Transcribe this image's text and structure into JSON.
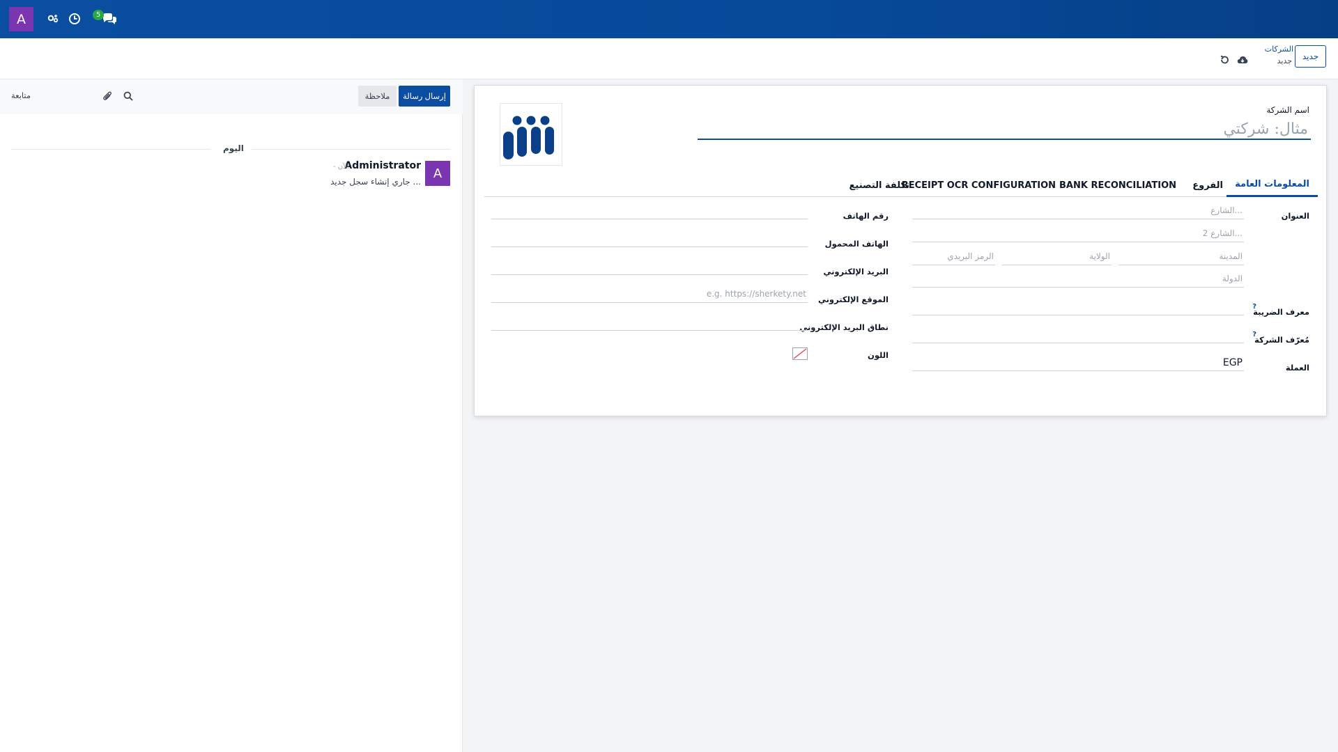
{
  "navbar": {
    "avatar_letter": "A",
    "messages_badge": "5",
    "icons": [
      "settings-users-icon",
      "clock-icon",
      "chat-bubbles-icon"
    ],
    "bg_color": "#0b4ea1"
  },
  "control_panel": {
    "new_button": "جديد",
    "breadcrumb_parent": "الشركات",
    "breadcrumb_current": "جديد",
    "icons": [
      "cloud-save-icon",
      "discard-icon"
    ]
  },
  "form": {
    "company_name_label": "اسم الشركة",
    "company_name_placeholder": "مثال: شركتي",
    "tabs": [
      {
        "label": "المعلومات العامة",
        "active": true
      },
      {
        "label": "الفروع",
        "active": false
      },
      {
        "label": "BANK RECONCILIATION",
        "active": false
      },
      {
        "label": "RECEIPT OCR CONFIGURATION",
        "active": false
      },
      {
        "label": "تكلفة التصنيع",
        "active": false
      }
    ],
    "address_label": "العنوان",
    "street_placeholder": "الشارع...",
    "street2_placeholder": "الشارع 2...",
    "city_placeholder": "المدينة",
    "state_placeholder": "الولاية",
    "zip_placeholder": "الرمز البريدي",
    "country_placeholder": "الدولة",
    "tax_id_label": "معرف الضريبة",
    "company_id_label": "مُعرّف الشركة",
    "help_mark": "?",
    "currency_label": "العملة",
    "currency_value": "EGP",
    "phone_label": "رقم الهاتف",
    "mobile_label": "الهاتف المحمول",
    "email_label": "البريد الإلكتروني",
    "website_label": "الموقع الإلكتروني",
    "website_placeholder": "e.g. https://sherkety.net",
    "email_domain_label": "نطاق البريد الإلكتروني",
    "color_label": "اللون"
  },
  "chatter": {
    "send_message_button": "إرسال رسالة",
    "log_note_button": "ملاحظة",
    "follow_label": "متابعة",
    "icons": [
      "search-icon",
      "paperclip-icon"
    ],
    "day_separator": "اليوم",
    "messages": [
      {
        "avatar": "A",
        "author": "Administrator",
        "time": "- الآن",
        "body": "جاري إنشاء سجل جديد ..."
      }
    ]
  },
  "colors": {
    "primary": "#0b4ea1",
    "avatar_purple": "#7b35b0",
    "badge_green": "#28a745",
    "form_background": "#f3f4f6"
  }
}
